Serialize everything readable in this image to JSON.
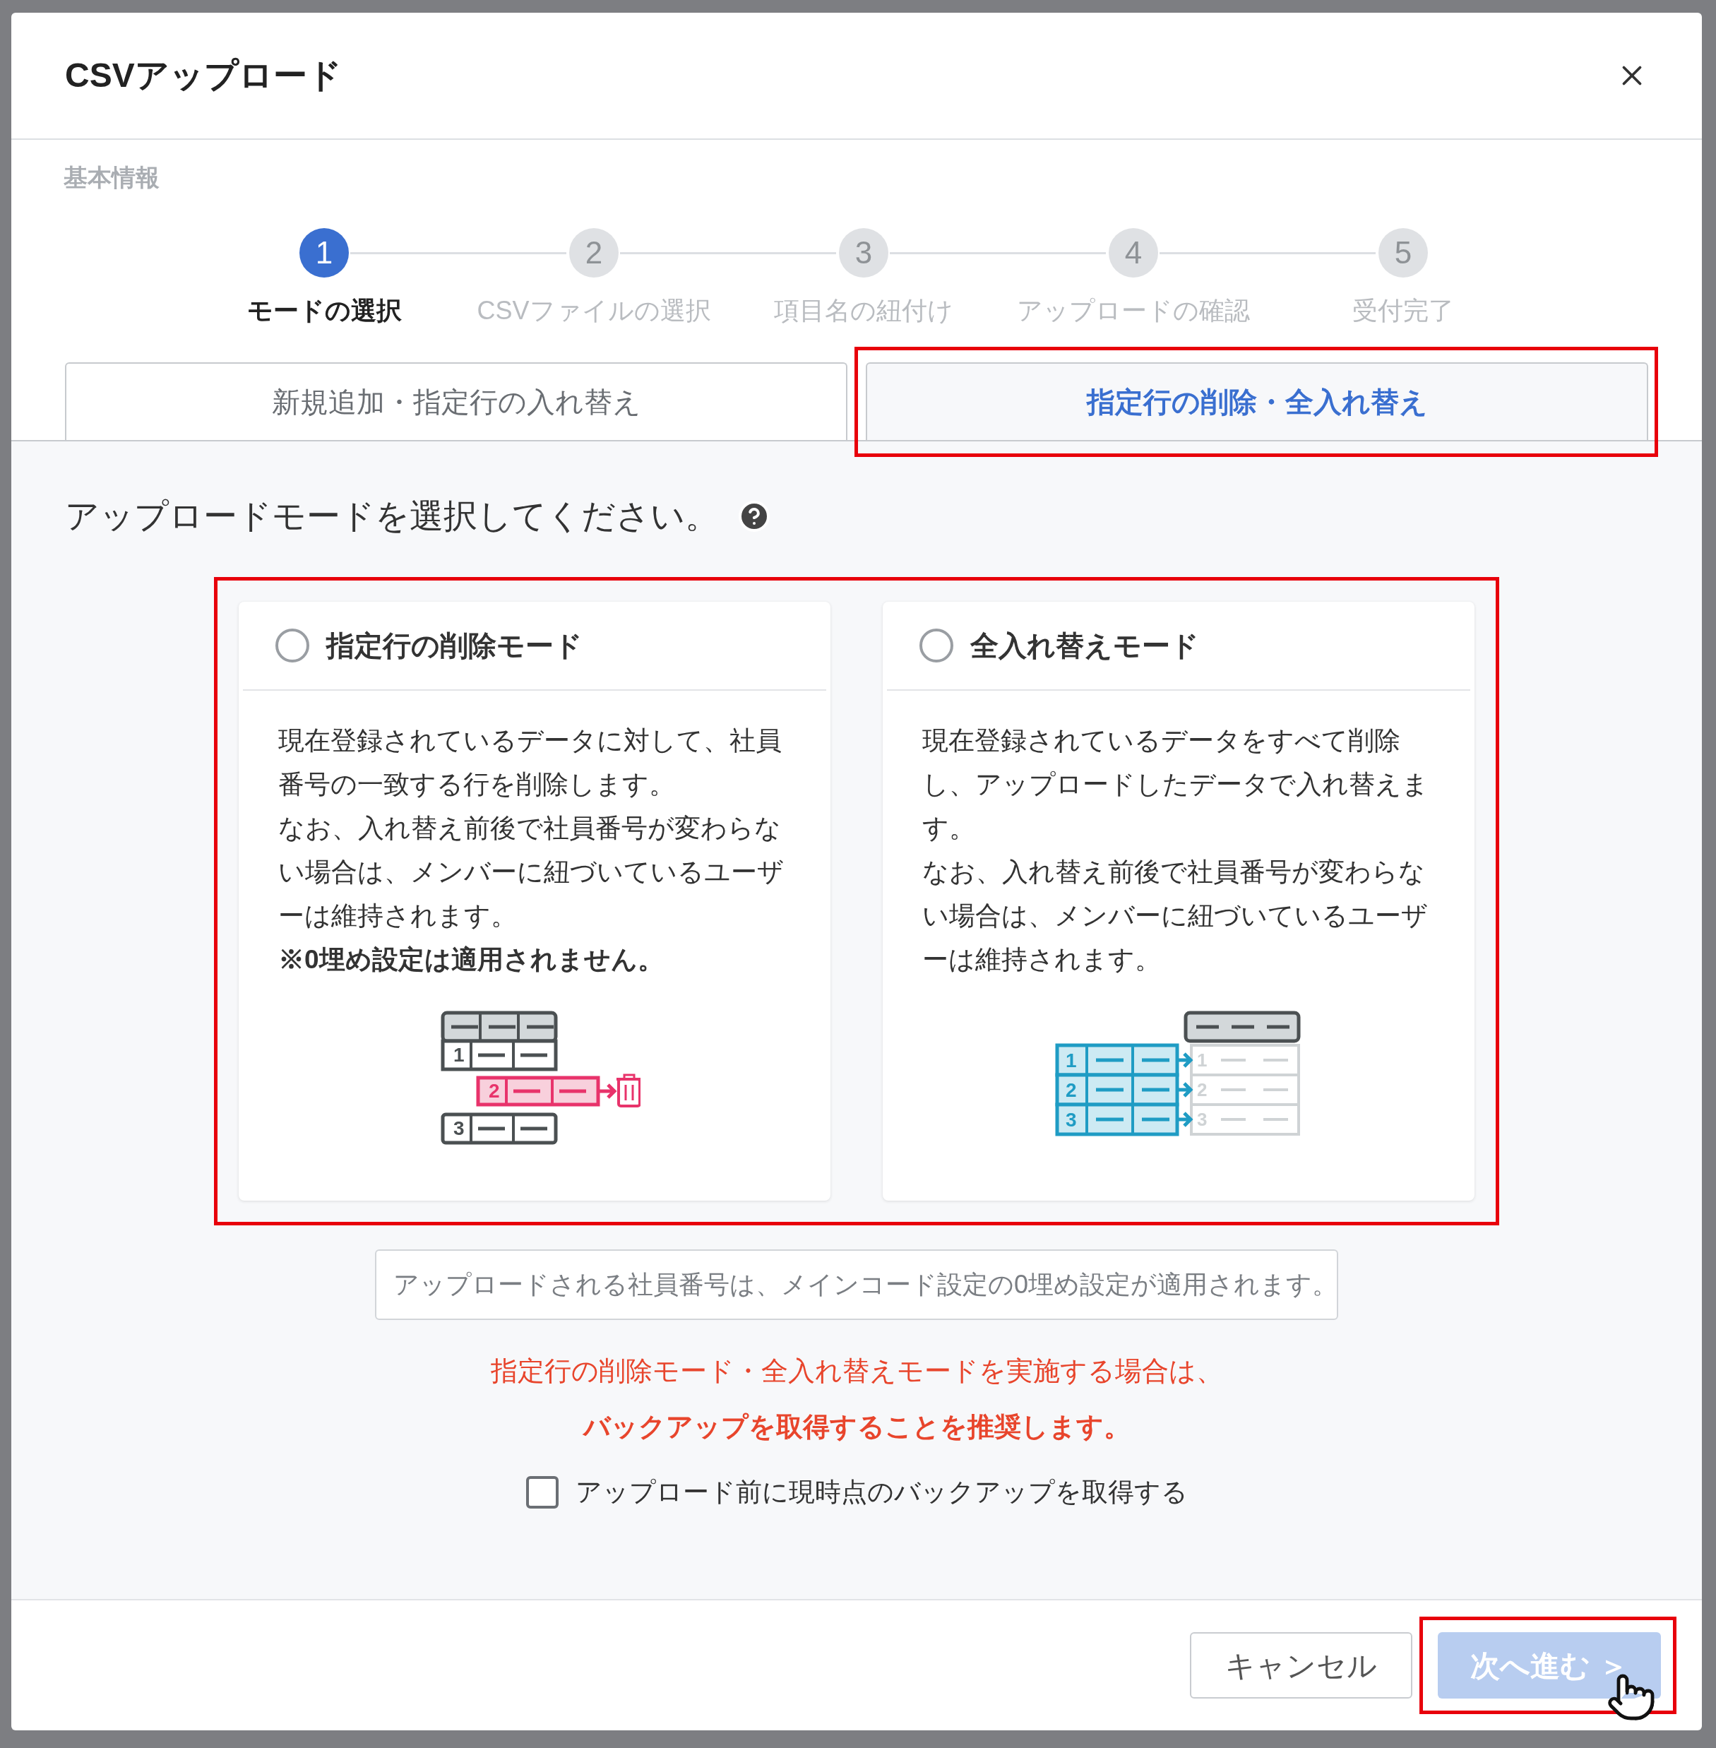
{
  "dialog": {
    "title": "CSVアップロード",
    "section_label": "基本情報"
  },
  "steps": [
    {
      "number": "1",
      "label": "モードの選択",
      "selected": true
    },
    {
      "number": "2",
      "label": "CSVファイルの選択",
      "selected": false
    },
    {
      "number": "3",
      "label": "項目名の紐付け",
      "selected": false
    },
    {
      "number": "4",
      "label": "アップロードの確認",
      "selected": false
    },
    {
      "number": "5",
      "label": "受付完了",
      "selected": false
    }
  ],
  "tabs": [
    {
      "label": "新規追加・指定行の入れ替え",
      "selected": false,
      "highlighted": false
    },
    {
      "label": "指定行の削除・全入れ替え",
      "selected": true,
      "highlighted": true
    }
  ],
  "prompt": "アップロードモードを選択してください。",
  "mode_cards": [
    {
      "kind": "delete",
      "title": "指定行の削除モード",
      "checked": false,
      "lines": [
        "現在登録されているデータに対して、社員番号の一致する行を削除します。",
        "なお、入れ替え前後で社員番号が変わらない場合は、メンバーに紐づいているユーザーは維持されます。"
      ],
      "note": "※0埋め設定は適用されません。",
      "row_labels": [
        "1",
        "2",
        "3"
      ]
    },
    {
      "kind": "replace",
      "title": "全入れ替えモード",
      "checked": false,
      "lines": [
        "現在登録されているデータをすべて削除し、アップロードしたデータで入れ替えます。",
        "なお、入れ替え前後で社員番号が変わらない場合は、メンバーに紐づいているユーザーは維持されます。"
      ],
      "row_labels": [
        "1",
        "2",
        "3"
      ],
      "old_row_labels": [
        "1",
        "2",
        "3"
      ]
    }
  ],
  "info": "アップロードされる社員番号は、メインコード設定の0埋め設定が適用されます。",
  "warning": [
    "指定行の削除モード・全入れ替えモードを実施する場合は、",
    "バックアップを取得することを推奨します。"
  ],
  "backup_checkbox": {
    "label": "アップロード前に現時点のバックアップを取得する",
    "checked": false
  },
  "buttons": [
    {
      "kind": "cancel",
      "label": "キャンセル",
      "disabled": false,
      "highlighted": false
    },
    {
      "kind": "next",
      "label": "次へ進む ＞",
      "disabled": true,
      "highlighted": true
    }
  ]
}
